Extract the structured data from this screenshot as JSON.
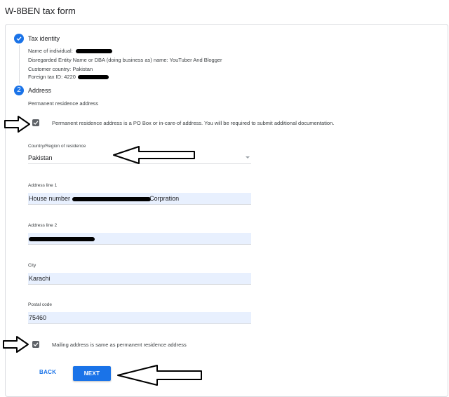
{
  "page": {
    "title": "W-8BEN tax form"
  },
  "step1": {
    "title": "Tax identity",
    "name_label": "Name of individual:",
    "dba_line": "Disregarded Entity Name or DBA (doing business as) name: YouTuber And Blogger",
    "country_line": "Customer country: Pakistan",
    "tax_id_label": "Foreign tax ID: 4220"
  },
  "step2": {
    "number": "2",
    "title": "Address",
    "section_label": "Permanent residence address",
    "po_box_label": "Permanent residence address is a PO Box or in-care-of address. You will be required to submit additional documentation.",
    "country": {
      "label": "Country/Region of residence",
      "value": "Pakistan"
    },
    "address1": {
      "label": "Address line 1",
      "value_start": "House number",
      "value_end": "Corpration"
    },
    "address2": {
      "label": "Address line 2"
    },
    "city": {
      "label": "City",
      "value": "Karachi"
    },
    "postal": {
      "label": "Postal code",
      "value": "75460"
    },
    "mailing_label": "Mailing address is same as permanent residence address"
  },
  "buttons": {
    "back": "BACK",
    "next": "NEXT"
  },
  "colors": {
    "accent": "#1a73e8",
    "field_fill": "#e8f0fe",
    "checkbox": "#5f6368"
  },
  "icons": [
    "check-icon",
    "arrow-annotation"
  ]
}
